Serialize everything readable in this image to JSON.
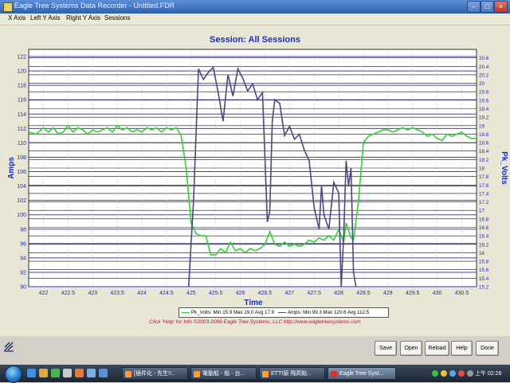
{
  "window": {
    "title": "Eagle Tree Systems Data Recorder - Untitled.FDR",
    "min_label": "–",
    "max_label": "□",
    "close_label": "×"
  },
  "menu": [
    "X Axis",
    "Left Y Axis",
    "Right Y Axis",
    "Sessions"
  ],
  "chart_data": {
    "type": "line",
    "title": "Session: All Sessions",
    "xlabel": "Time",
    "ylabel_left": "Amps",
    "ylabel_right": "Pk_Volts",
    "xlim": [
      421.7,
      430.8
    ],
    "ylim_left": [
      90,
      123
    ],
    "ylim_right": [
      15.2,
      20.8
    ],
    "x_ticks": [
      "422",
      "422.5",
      "423",
      "423.5",
      "424",
      "424.5",
      "425",
      "425.5",
      "426",
      "426.5",
      "427",
      "427.5",
      "428",
      "428.5",
      "429",
      "429.5",
      "430",
      "430.5"
    ],
    "y_left_ticks": [
      "90",
      "92",
      "94",
      "96",
      "98",
      "100",
      "102",
      "104",
      "106",
      "108",
      "110",
      "112",
      "114",
      "116",
      "118",
      "120",
      "122"
    ],
    "y_right_ticks": [
      "15.2",
      "15.4",
      "15.6",
      "15.8",
      "16",
      "16.2",
      "16.4",
      "16.6",
      "16.8",
      "17",
      "17.2",
      "17.4",
      "17.6",
      "17.8",
      "18",
      "18.2",
      "18.4",
      "18.6",
      "18.8",
      "19",
      "19.2",
      "19.4",
      "19.6",
      "19.8",
      "20",
      "20.2",
      "20.4",
      "20.6"
    ],
    "grid": true,
    "series": [
      {
        "name": "Pk_Volts",
        "axis": "right",
        "color": "#2fd42f",
        "x": [
          421.7,
          421.85,
          422.0,
          422.1,
          422.2,
          422.3,
          422.4,
          422.5,
          422.6,
          422.7,
          422.8,
          422.9,
          423.0,
          423.1,
          423.2,
          423.3,
          423.4,
          423.5,
          423.6,
          423.7,
          423.8,
          423.9,
          424.0,
          424.1,
          424.2,
          424.3,
          424.4,
          424.5,
          424.6,
          424.7,
          424.8,
          424.9,
          425.0,
          425.1,
          425.2,
          425.3,
          425.4,
          425.5,
          425.6,
          425.7,
          425.8,
          425.9,
          426.0,
          426.1,
          426.2,
          426.3,
          426.4,
          426.5,
          426.6,
          426.7,
          426.8,
          426.9,
          427.0,
          427.1,
          427.2,
          427.3,
          427.4,
          427.5,
          427.6,
          427.7,
          427.8,
          427.9,
          428.0,
          428.1,
          428.15,
          428.25,
          428.3,
          428.4,
          428.5,
          428.6,
          428.7,
          428.8,
          428.9,
          429.0,
          429.1,
          429.2,
          429.3,
          429.4,
          429.5,
          429.6,
          429.7,
          429.8,
          429.9,
          430.0,
          430.1,
          430.2,
          430.3,
          430.4,
          430.5,
          430.6,
          430.7,
          430.8
        ],
        "y": [
          18.85,
          18.8,
          18.95,
          18.85,
          18.95,
          18.8,
          18.85,
          19.0,
          18.85,
          18.95,
          18.9,
          18.8,
          18.9,
          18.85,
          18.9,
          18.95,
          18.85,
          19.0,
          18.9,
          18.95,
          18.85,
          18.9,
          18.85,
          18.95,
          18.9,
          18.95,
          18.85,
          18.95,
          18.9,
          18.95,
          18.75,
          18.0,
          16.7,
          16.45,
          16.4,
          16.4,
          15.95,
          15.95,
          16.1,
          16.0,
          16.25,
          16.05,
          16.1,
          16.0,
          16.1,
          16.05,
          16.1,
          16.2,
          16.5,
          16.2,
          16.15,
          16.25,
          16.15,
          16.2,
          16.15,
          16.2,
          16.3,
          16.25,
          16.35,
          16.3,
          16.4,
          16.3,
          16.55,
          16.25,
          16.7,
          16.35,
          16.3,
          17.2,
          18.6,
          18.75,
          18.8,
          18.85,
          18.9,
          18.9,
          18.85,
          18.9,
          18.95,
          18.9,
          18.95,
          18.9,
          18.85,
          18.75,
          18.8,
          18.7,
          18.65,
          18.8,
          18.75,
          18.8,
          18.85,
          18.75,
          18.7,
          18.7
        ]
      },
      {
        "name": "Amps",
        "axis": "left",
        "color": "#4e477c",
        "x": [
          424.95,
          425.05,
          425.15,
          425.25,
          425.35,
          425.45,
          425.55,
          425.65,
          425.75,
          425.85,
          425.95,
          426.05,
          426.15,
          426.25,
          426.35,
          426.45,
          426.55,
          426.6,
          426.65,
          426.7,
          426.8,
          426.9,
          427.0,
          427.1,
          427.2,
          427.3,
          427.4,
          427.5,
          427.6,
          427.65,
          427.7,
          427.8,
          427.9,
          428.0,
          428.05,
          428.1,
          428.15,
          428.2,
          428.25,
          428.3,
          428.35
        ],
        "y": [
          90.0,
          102.0,
          120.3,
          118.8,
          119.8,
          120.5,
          117.0,
          113.0,
          119.5,
          116.5,
          120.3,
          119.0,
          117.2,
          118.2,
          116.0,
          117.0,
          99.0,
          100.5,
          113.0,
          116.0,
          115.5,
          111.0,
          112.3,
          110.5,
          111.2,
          109.0,
          107.5,
          101.0,
          98.0,
          104.0,
          100.0,
          98.0,
          104.5,
          103.0,
          90.0,
          97.0,
          107.5,
          104.0,
          106.5,
          92.0,
          90.0
        ]
      }
    ]
  },
  "legend": {
    "pk_volts": "Pk_Volts:  Min 15.9 Max 19.0 Avg 17.9",
    "amps": "Amps:  Min 99.3 Max 120.6 Avg 112.5"
  },
  "footer_note": "Click 'Help' for Info   ©2003-2006 Eagle Tree Systems, LLC    http://www.eagletreesystems.com",
  "buttons": {
    "save": "Save",
    "open": "Open",
    "reload": "Reload",
    "help": "Help",
    "done": "Done"
  },
  "taskbar": {
    "tasks": [
      "[插件化 - 先生!!..",
      "電動船 - 船 - 台...",
      "ETTI源 飛高點...",
      "Eagle Tree Syst..."
    ],
    "clock": "上午 02:26"
  },
  "colors": {
    "plot_bg": "#ffffff",
    "grid_major": "#3a3ad0",
    "grid_minor": "#111111",
    "volts": "#2fd42f",
    "amps": "#4e477c",
    "axis_text": "#1a2fb8"
  }
}
